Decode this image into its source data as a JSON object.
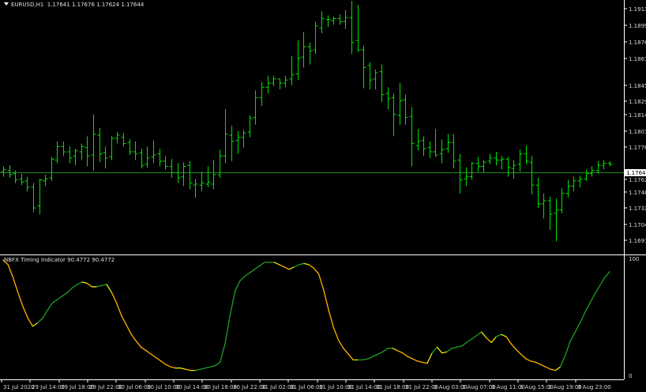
{
  "main_chart": {
    "symbol_label": "EURUSD,H1",
    "ohlc_values": [
      "1.17641",
      "1.17676",
      "1.17624",
      "1.17644"
    ],
    "price_axis_labels": [
      "1.19135",
      "1.18990",
      "1.18765",
      "1.18610",
      "1.18455",
      "1.18295",
      "1.18140",
      "1.18010",
      "1.17780",
      "1.17624",
      "1.17460",
      "1.17320",
      "1.17045",
      "1.16910"
    ],
    "current_price": "1.17644",
    "bar_color": "#00e000",
    "current_price_line_color": "#1f8a1f"
  },
  "indicator": {
    "label": "NBFX Timing Indicator 90.4772 90.4772",
    "scale_labels": [
      "100",
      "0"
    ],
    "colors": {
      "rising": "#1fa01f",
      "falling": "#ffb000",
      "turn": "#e8e800"
    }
  },
  "time_axis": {
    "labels": [
      "31 Jul 2020",
      "29 Jul 14:00",
      "29 Jul 18:00",
      "29 Jul 22:00",
      "30 Jul 06:00",
      "30 Jul 10:00",
      "30 Jul 14:00",
      "30 Jul 18:00",
      "30 Jul 22:00",
      "31 Jul 02:00",
      "31 Jul 06:00",
      "31 Jul 10:00",
      "31 Jul 14:00",
      "31 Jul 18:00",
      "31 Jul 22:00",
      "3 Aug 03:00",
      "3 Aug 07:00",
      "3 Aug 11:00",
      "3 Aug 15:00",
      "3 Aug 19:00",
      "3 Aug 23:00"
    ]
  },
  "chart_data": [
    {
      "type": "ohlc",
      "name": "EURUSD,H1",
      "bars": [
        [
          1.1757,
          1.1762,
          1.1752,
          1.1759
        ],
        [
          1.1758,
          1.1763,
          1.1751,
          1.1754
        ],
        [
          1.1755,
          1.1758,
          1.1746,
          1.1749
        ],
        [
          1.175,
          1.1755,
          1.1744,
          1.1747
        ],
        [
          1.1748,
          1.1752,
          1.1738,
          1.1742
        ],
        [
          1.1742,
          1.1746,
          1.1718,
          1.1722
        ],
        [
          1.1724,
          1.175,
          1.1716,
          1.1749
        ],
        [
          1.1748,
          1.1754,
          1.1743,
          1.175
        ],
        [
          1.1751,
          1.1771,
          1.1748,
          1.1769
        ],
        [
          1.1768,
          1.1786,
          1.1765,
          1.1781
        ],
        [
          1.1781,
          1.1786,
          1.1772,
          1.1776
        ],
        [
          1.1776,
          1.1781,
          1.1765,
          1.177
        ],
        [
          1.1772,
          1.1779,
          1.1763,
          1.1777
        ],
        [
          1.1776,
          1.1784,
          1.1768,
          1.1781
        ],
        [
          1.178,
          1.1791,
          1.1762,
          1.1772
        ],
        [
          1.1773,
          1.1812,
          1.1758,
          1.1793
        ],
        [
          1.1792,
          1.1799,
          1.1766,
          1.1774
        ],
        [
          1.1775,
          1.1781,
          1.176,
          1.177
        ],
        [
          1.1771,
          1.1791,
          1.1768,
          1.1789
        ],
        [
          1.1789,
          1.1795,
          1.1784,
          1.1792
        ],
        [
          1.179,
          1.1794,
          1.1781,
          1.1784
        ],
        [
          1.1785,
          1.1788,
          1.1773,
          1.1776
        ],
        [
          1.1776,
          1.1786,
          1.1768,
          1.1774
        ],
        [
          1.1775,
          1.1779,
          1.176,
          1.1763
        ],
        [
          1.1764,
          1.1781,
          1.1761,
          1.177
        ],
        [
          1.1771,
          1.1787,
          1.1765,
          1.1773
        ],
        [
          1.1774,
          1.1779,
          1.1762,
          1.1767
        ],
        [
          1.1767,
          1.1772,
          1.1759,
          1.1762
        ],
        [
          1.1762,
          1.1769,
          1.1751,
          1.1756
        ],
        [
          1.1756,
          1.1765,
          1.1746,
          1.1751
        ],
        [
          1.1752,
          1.1766,
          1.1743,
          1.1762
        ],
        [
          1.1763,
          1.1767,
          1.174,
          1.1746
        ],
        [
          1.1744,
          1.175,
          1.1732,
          1.1745
        ],
        [
          1.1744,
          1.1757,
          1.1738,
          1.1746
        ],
        [
          1.1745,
          1.1762,
          1.1742,
          1.1747
        ],
        [
          1.1745,
          1.1768,
          1.174,
          1.1754
        ],
        [
          1.1754,
          1.1778,
          1.1751,
          1.1772
        ],
        [
          1.1772,
          1.1817,
          1.1765,
          1.1793
        ],
        [
          1.1792,
          1.1801,
          1.1767,
          1.1786
        ],
        [
          1.1787,
          1.1796,
          1.1774,
          1.179
        ],
        [
          1.179,
          1.1797,
          1.178,
          1.1794
        ],
        [
          1.1795,
          1.1811,
          1.179,
          1.1808
        ],
        [
          1.1809,
          1.1835,
          1.1802,
          1.1828
        ],
        [
          1.1828,
          1.1843,
          1.182,
          1.1838
        ],
        [
          1.1838,
          1.1849,
          1.1832,
          1.1842
        ],
        [
          1.1842,
          1.1849,
          1.1839,
          1.1846
        ],
        [
          1.1846,
          1.1846,
          1.1836,
          1.1842
        ],
        [
          1.1842,
          1.1849,
          1.1838,
          1.1845
        ],
        [
          1.1846,
          1.1868,
          1.184,
          1.185
        ],
        [
          1.1851,
          1.1883,
          1.1845,
          1.1866
        ],
        [
          1.1867,
          1.1891,
          1.1857,
          1.1877
        ],
        [
          1.1877,
          1.1881,
          1.186,
          1.1873
        ],
        [
          1.1874,
          1.1901,
          1.187,
          1.1897
        ],
        [
          1.1895,
          1.1911,
          1.189,
          1.1904
        ],
        [
          1.1903,
          1.1907,
          1.1896,
          1.1903
        ],
        [
          1.1902,
          1.1906,
          1.1898,
          1.1904
        ],
        [
          1.1904,
          1.1908,
          1.1898,
          1.1901
        ],
        [
          1.1901,
          1.1912,
          1.1894,
          1.1905
        ],
        [
          1.1905,
          1.1921,
          1.187,
          1.1881
        ],
        [
          1.1883,
          1.1917,
          1.1872,
          1.1874
        ],
        [
          1.1874,
          1.1878,
          1.1837,
          1.1857
        ],
        [
          1.1859,
          1.1862,
          1.1836,
          1.1845
        ],
        [
          1.1846,
          1.1855,
          1.1836,
          1.1852
        ],
        [
          1.1853,
          1.186,
          1.1824,
          1.1831
        ],
        [
          1.1832,
          1.1838,
          1.1817,
          1.1827
        ],
        [
          1.1828,
          1.1832,
          1.1791,
          1.1812
        ],
        [
          1.1811,
          1.1842,
          1.1802,
          1.1825
        ],
        [
          1.1826,
          1.1831,
          1.1802,
          1.1809
        ],
        [
          1.181,
          1.1819,
          1.1762,
          1.1784
        ],
        [
          1.1782,
          1.1798,
          1.1777,
          1.1786
        ],
        [
          1.1787,
          1.1791,
          1.1772,
          1.1779
        ],
        [
          1.178,
          1.1786,
          1.177,
          1.1776
        ],
        [
          1.1776,
          1.1798,
          1.1771,
          1.1773
        ],
        [
          1.1774,
          1.1788,
          1.1765,
          1.1778
        ],
        [
          1.1779,
          1.1793,
          1.1775,
          1.1785
        ],
        [
          1.1785,
          1.1793,
          1.176,
          1.1767
        ],
        [
          1.1768,
          1.1774,
          1.1736,
          1.1749
        ],
        [
          1.175,
          1.1761,
          1.1743,
          1.1752
        ],
        [
          1.1752,
          1.1766,
          1.1749,
          1.1765
        ],
        [
          1.1765,
          1.1771,
          1.1757,
          1.1762
        ],
        [
          1.1762,
          1.1768,
          1.1756,
          1.1766
        ],
        [
          1.1767,
          1.1774,
          1.1764,
          1.177
        ],
        [
          1.177,
          1.1776,
          1.1763,
          1.1768
        ],
        [
          1.1768,
          1.1772,
          1.1759,
          1.1769
        ],
        [
          1.1769,
          1.1771,
          1.1752,
          1.1761
        ],
        [
          1.176,
          1.1768,
          1.175,
          1.1763
        ],
        [
          1.1764,
          1.1778,
          1.1757,
          1.1774
        ],
        [
          1.1774,
          1.1782,
          1.1764,
          1.1767
        ],
        [
          1.1766,
          1.1772,
          1.1735,
          1.1744
        ],
        [
          1.1744,
          1.1751,
          1.1722,
          1.1726
        ],
        [
          1.1726,
          1.1736,
          1.1712,
          1.1729
        ],
        [
          1.1729,
          1.1733,
          1.1701,
          1.1716
        ],
        [
          1.1717,
          1.1731,
          1.169,
          1.172
        ],
        [
          1.172,
          1.1741,
          1.1717,
          1.1736
        ],
        [
          1.1736,
          1.1749,
          1.1732,
          1.1743
        ],
        [
          1.1743,
          1.1752,
          1.1738,
          1.1748
        ],
        [
          1.1748,
          1.1753,
          1.1742,
          1.175
        ],
        [
          1.175,
          1.1759,
          1.1748,
          1.1755
        ],
        [
          1.1755,
          1.1762,
          1.1752,
          1.1758
        ],
        [
          1.1758,
          1.1767,
          1.1755,
          1.1763
        ],
        [
          1.1763,
          1.1768,
          1.1759,
          1.1765
        ],
        [
          1.1765,
          1.1767,
          1.1762,
          1.1764
        ]
      ]
    },
    {
      "type": "line",
      "name": "NBFX Timing Indicator",
      "ylim": [
        0,
        100
      ],
      "values": [
        100,
        96,
        85,
        72,
        60,
        50,
        43,
        46,
        50,
        57,
        63,
        66,
        69,
        72,
        76,
        79,
        81,
        80,
        77,
        77,
        78,
        79,
        72,
        63,
        52,
        44,
        36,
        30,
        25,
        22,
        19,
        16,
        13,
        10,
        8,
        7,
        7,
        6,
        5,
        5,
        6,
        7,
        8,
        9,
        12,
        28,
        52,
        73,
        82,
        86,
        89,
        92,
        95,
        98,
        98,
        98,
        96,
        94,
        92,
        94,
        96,
        97,
        96,
        93,
        88,
        74,
        57,
        42,
        31,
        24,
        19,
        14,
        14,
        14,
        15,
        17,
        19,
        21,
        24,
        24,
        22,
        20,
        17,
        15,
        13,
        12,
        11,
        20,
        25,
        20,
        21,
        24,
        25,
        26,
        29,
        32,
        35,
        38,
        33,
        29,
        34,
        36,
        34,
        28,
        23,
        19,
        15,
        13,
        12,
        10,
        8,
        6,
        5,
        8,
        18,
        30,
        38,
        46,
        55,
        63,
        71,
        78,
        85,
        90
      ]
    }
  ]
}
